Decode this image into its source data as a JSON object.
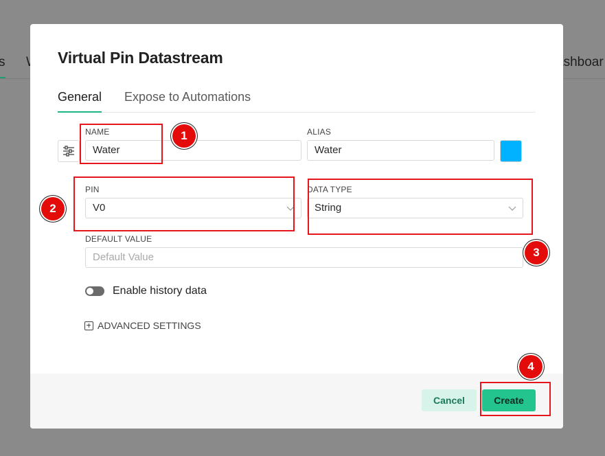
{
  "background": {
    "tab_left": "s",
    "tab_left2": "W",
    "tab_right": "ashboar"
  },
  "modal": {
    "title": "Virtual Pin Datastream",
    "tabs": [
      {
        "label": "General",
        "active": true
      },
      {
        "label": "Expose to Automations",
        "active": false
      }
    ],
    "name": {
      "label": "NAME",
      "value": "Water"
    },
    "alias": {
      "label": "ALIAS",
      "value": "Water",
      "color": "#00b2ff"
    },
    "pin": {
      "label": "PIN",
      "value": "V0"
    },
    "data_type": {
      "label": "DATA TYPE",
      "value": "String"
    },
    "default_value": {
      "label": "DEFAULT VALUE",
      "placeholder": "Default Value"
    },
    "history_toggle": {
      "label": "Enable history data",
      "enabled": false
    },
    "advanced_settings": {
      "label": "ADVANCED SETTINGS"
    },
    "footer": {
      "cancel_label": "Cancel",
      "create_label": "Create"
    }
  },
  "annotations": {
    "markers": [
      "1",
      "2",
      "3",
      "4"
    ],
    "color": "#e8141b"
  }
}
